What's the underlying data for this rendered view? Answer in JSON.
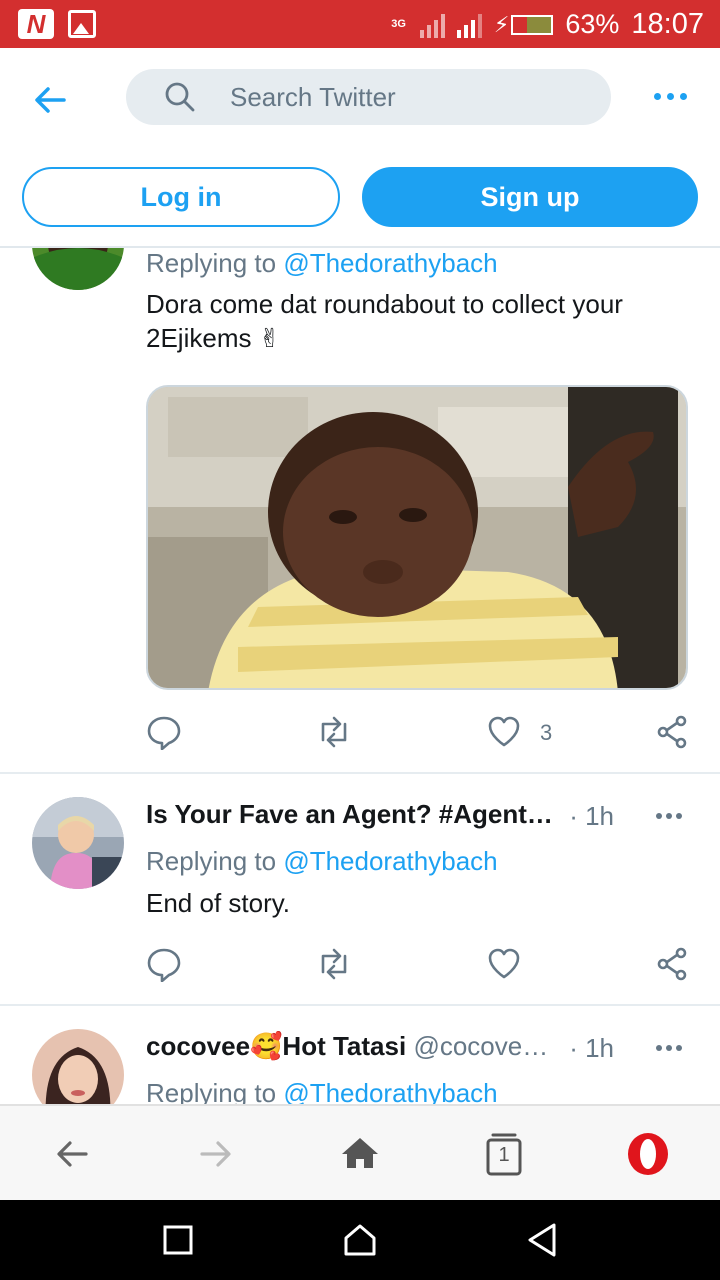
{
  "status_bar": {
    "network_label": "3G",
    "battery_percent": "63%",
    "battery_level": 0.63,
    "time": "18:07",
    "color": "#d32f2f"
  },
  "header": {
    "search_placeholder": "Search Twitter",
    "login_label": "Log in",
    "signup_label": "Sign up",
    "accent": "#1da1f2"
  },
  "tweets": [
    {
      "replying_prefix": "Replying to ",
      "replying_handle": "@Thedorathybach",
      "text_line1": "Dora come dat roundabout to collect your",
      "text_line2": "2Ejikems ✌",
      "likes": "3",
      "has_media": true
    },
    {
      "name": "Is Your Fave an Agent? #Agent…",
      "time": "· 1h",
      "replying_prefix": "Replying to ",
      "replying_handle": "@Thedorathybach",
      "text_line1": "End of story."
    },
    {
      "name": "cocovee🥰Hot Tatasi",
      "handle": "@cocove…",
      "time": "· 1h",
      "replying_prefix": "Replying to ",
      "replying_handle": "@Thedorathybach"
    }
  ],
  "bottom_bar": {
    "tab_count": "1",
    "icons": [
      "back-icon",
      "forward-icon",
      "home-icon",
      "tabs-icon",
      "opera-icon"
    ]
  },
  "nav_bar": {
    "icons": [
      "recents-icon",
      "home-icon",
      "back-icon"
    ]
  }
}
